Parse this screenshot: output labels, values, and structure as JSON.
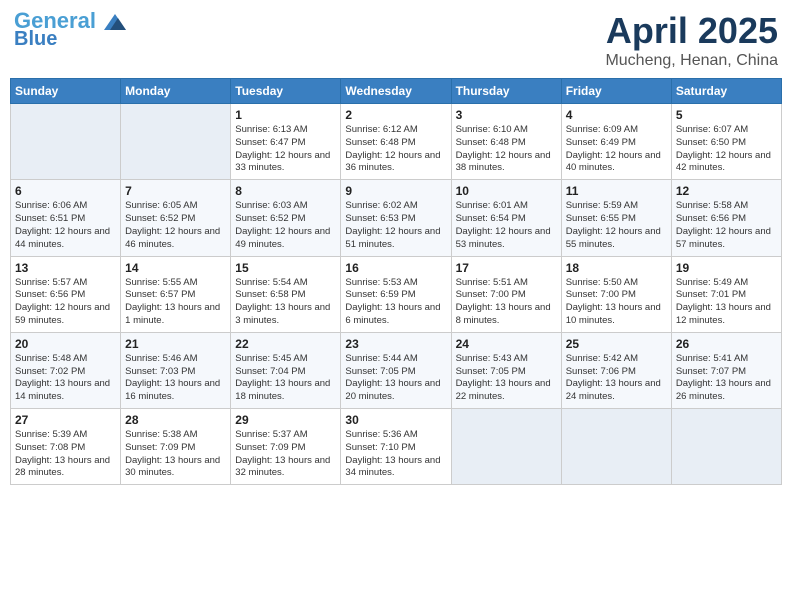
{
  "header": {
    "logo_line1": "General",
    "logo_line2": "Blue",
    "title": "April 2025",
    "subtitle": "Mucheng, Henan, China"
  },
  "weekdays": [
    "Sunday",
    "Monday",
    "Tuesday",
    "Wednesday",
    "Thursday",
    "Friday",
    "Saturday"
  ],
  "weeks": [
    [
      {
        "day": "",
        "empty": true
      },
      {
        "day": "",
        "empty": true
      },
      {
        "day": "1",
        "sunrise": "6:13 AM",
        "sunset": "6:47 PM",
        "daylight": "12 hours and 33 minutes."
      },
      {
        "day": "2",
        "sunrise": "6:12 AM",
        "sunset": "6:48 PM",
        "daylight": "12 hours and 36 minutes."
      },
      {
        "day": "3",
        "sunrise": "6:10 AM",
        "sunset": "6:48 PM",
        "daylight": "12 hours and 38 minutes."
      },
      {
        "day": "4",
        "sunrise": "6:09 AM",
        "sunset": "6:49 PM",
        "daylight": "12 hours and 40 minutes."
      },
      {
        "day": "5",
        "sunrise": "6:07 AM",
        "sunset": "6:50 PM",
        "daylight": "12 hours and 42 minutes."
      }
    ],
    [
      {
        "day": "6",
        "sunrise": "6:06 AM",
        "sunset": "6:51 PM",
        "daylight": "12 hours and 44 minutes."
      },
      {
        "day": "7",
        "sunrise": "6:05 AM",
        "sunset": "6:52 PM",
        "daylight": "12 hours and 46 minutes."
      },
      {
        "day": "8",
        "sunrise": "6:03 AM",
        "sunset": "6:52 PM",
        "daylight": "12 hours and 49 minutes."
      },
      {
        "day": "9",
        "sunrise": "6:02 AM",
        "sunset": "6:53 PM",
        "daylight": "12 hours and 51 minutes."
      },
      {
        "day": "10",
        "sunrise": "6:01 AM",
        "sunset": "6:54 PM",
        "daylight": "12 hours and 53 minutes."
      },
      {
        "day": "11",
        "sunrise": "5:59 AM",
        "sunset": "6:55 PM",
        "daylight": "12 hours and 55 minutes."
      },
      {
        "day": "12",
        "sunrise": "5:58 AM",
        "sunset": "6:56 PM",
        "daylight": "12 hours and 57 minutes."
      }
    ],
    [
      {
        "day": "13",
        "sunrise": "5:57 AM",
        "sunset": "6:56 PM",
        "daylight": "12 hours and 59 minutes."
      },
      {
        "day": "14",
        "sunrise": "5:55 AM",
        "sunset": "6:57 PM",
        "daylight": "13 hours and 1 minute."
      },
      {
        "day": "15",
        "sunrise": "5:54 AM",
        "sunset": "6:58 PM",
        "daylight": "13 hours and 3 minutes."
      },
      {
        "day": "16",
        "sunrise": "5:53 AM",
        "sunset": "6:59 PM",
        "daylight": "13 hours and 6 minutes."
      },
      {
        "day": "17",
        "sunrise": "5:51 AM",
        "sunset": "7:00 PM",
        "daylight": "13 hours and 8 minutes."
      },
      {
        "day": "18",
        "sunrise": "5:50 AM",
        "sunset": "7:00 PM",
        "daylight": "13 hours and 10 minutes."
      },
      {
        "day": "19",
        "sunrise": "5:49 AM",
        "sunset": "7:01 PM",
        "daylight": "13 hours and 12 minutes."
      }
    ],
    [
      {
        "day": "20",
        "sunrise": "5:48 AM",
        "sunset": "7:02 PM",
        "daylight": "13 hours and 14 minutes."
      },
      {
        "day": "21",
        "sunrise": "5:46 AM",
        "sunset": "7:03 PM",
        "daylight": "13 hours and 16 minutes."
      },
      {
        "day": "22",
        "sunrise": "5:45 AM",
        "sunset": "7:04 PM",
        "daylight": "13 hours and 18 minutes."
      },
      {
        "day": "23",
        "sunrise": "5:44 AM",
        "sunset": "7:05 PM",
        "daylight": "13 hours and 20 minutes."
      },
      {
        "day": "24",
        "sunrise": "5:43 AM",
        "sunset": "7:05 PM",
        "daylight": "13 hours and 22 minutes."
      },
      {
        "day": "25",
        "sunrise": "5:42 AM",
        "sunset": "7:06 PM",
        "daylight": "13 hours and 24 minutes."
      },
      {
        "day": "26",
        "sunrise": "5:41 AM",
        "sunset": "7:07 PM",
        "daylight": "13 hours and 26 minutes."
      }
    ],
    [
      {
        "day": "27",
        "sunrise": "5:39 AM",
        "sunset": "7:08 PM",
        "daylight": "13 hours and 28 minutes."
      },
      {
        "day": "28",
        "sunrise": "5:38 AM",
        "sunset": "7:09 PM",
        "daylight": "13 hours and 30 minutes."
      },
      {
        "day": "29",
        "sunrise": "5:37 AM",
        "sunset": "7:09 PM",
        "daylight": "13 hours and 32 minutes."
      },
      {
        "day": "30",
        "sunrise": "5:36 AM",
        "sunset": "7:10 PM",
        "daylight": "13 hours and 34 minutes."
      },
      {
        "day": "",
        "empty": true
      },
      {
        "day": "",
        "empty": true
      },
      {
        "day": "",
        "empty": true
      }
    ]
  ]
}
